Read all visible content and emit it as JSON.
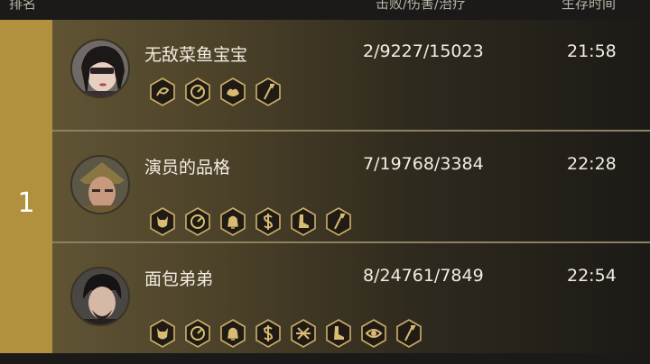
{
  "header": {
    "rank_label": "排名",
    "stats_label": "击败/伤害/治疗",
    "time_label": "生存时间"
  },
  "rank": "1",
  "colors": {
    "gold": "#b2913e",
    "row_gradient_start": "#605434",
    "divider": "#8c8160",
    "badge_gold": "#d9bb72",
    "badge_bg": "#201c15"
  },
  "players": [
    {
      "name": "无敌菜鱼宝宝",
      "stats": "2/9227/15023",
      "time": "21:58",
      "avatar_icon": "masked-female-hero-avatar",
      "badges": [
        "swirl-badge-icon",
        "spiral-badge-icon",
        "muscle-badge-icon",
        "spear-badge-icon"
      ]
    },
    {
      "name": "演员的品格",
      "stats": "7/19768/3384",
      "time": "22:28",
      "avatar_icon": "armored-warrior-avatar",
      "badges": [
        "demon-mask-badge-icon",
        "spiral-badge-icon",
        "bell-badge-icon",
        "dollar-badge-icon",
        "boot-badge-icon",
        "spear-badge-icon"
      ]
    },
    {
      "name": "面包弟弟",
      "stats": "8/24761/7849",
      "time": "22:54",
      "avatar_icon": "bearded-swordsman-avatar",
      "badges": [
        "demon-mask-badge-icon",
        "spiral-badge-icon",
        "bell-badge-icon",
        "dollar-badge-icon",
        "crossed-swords-badge-icon",
        "boot-badge-icon",
        "eye-badge-icon",
        "spear-badge-icon"
      ]
    }
  ]
}
